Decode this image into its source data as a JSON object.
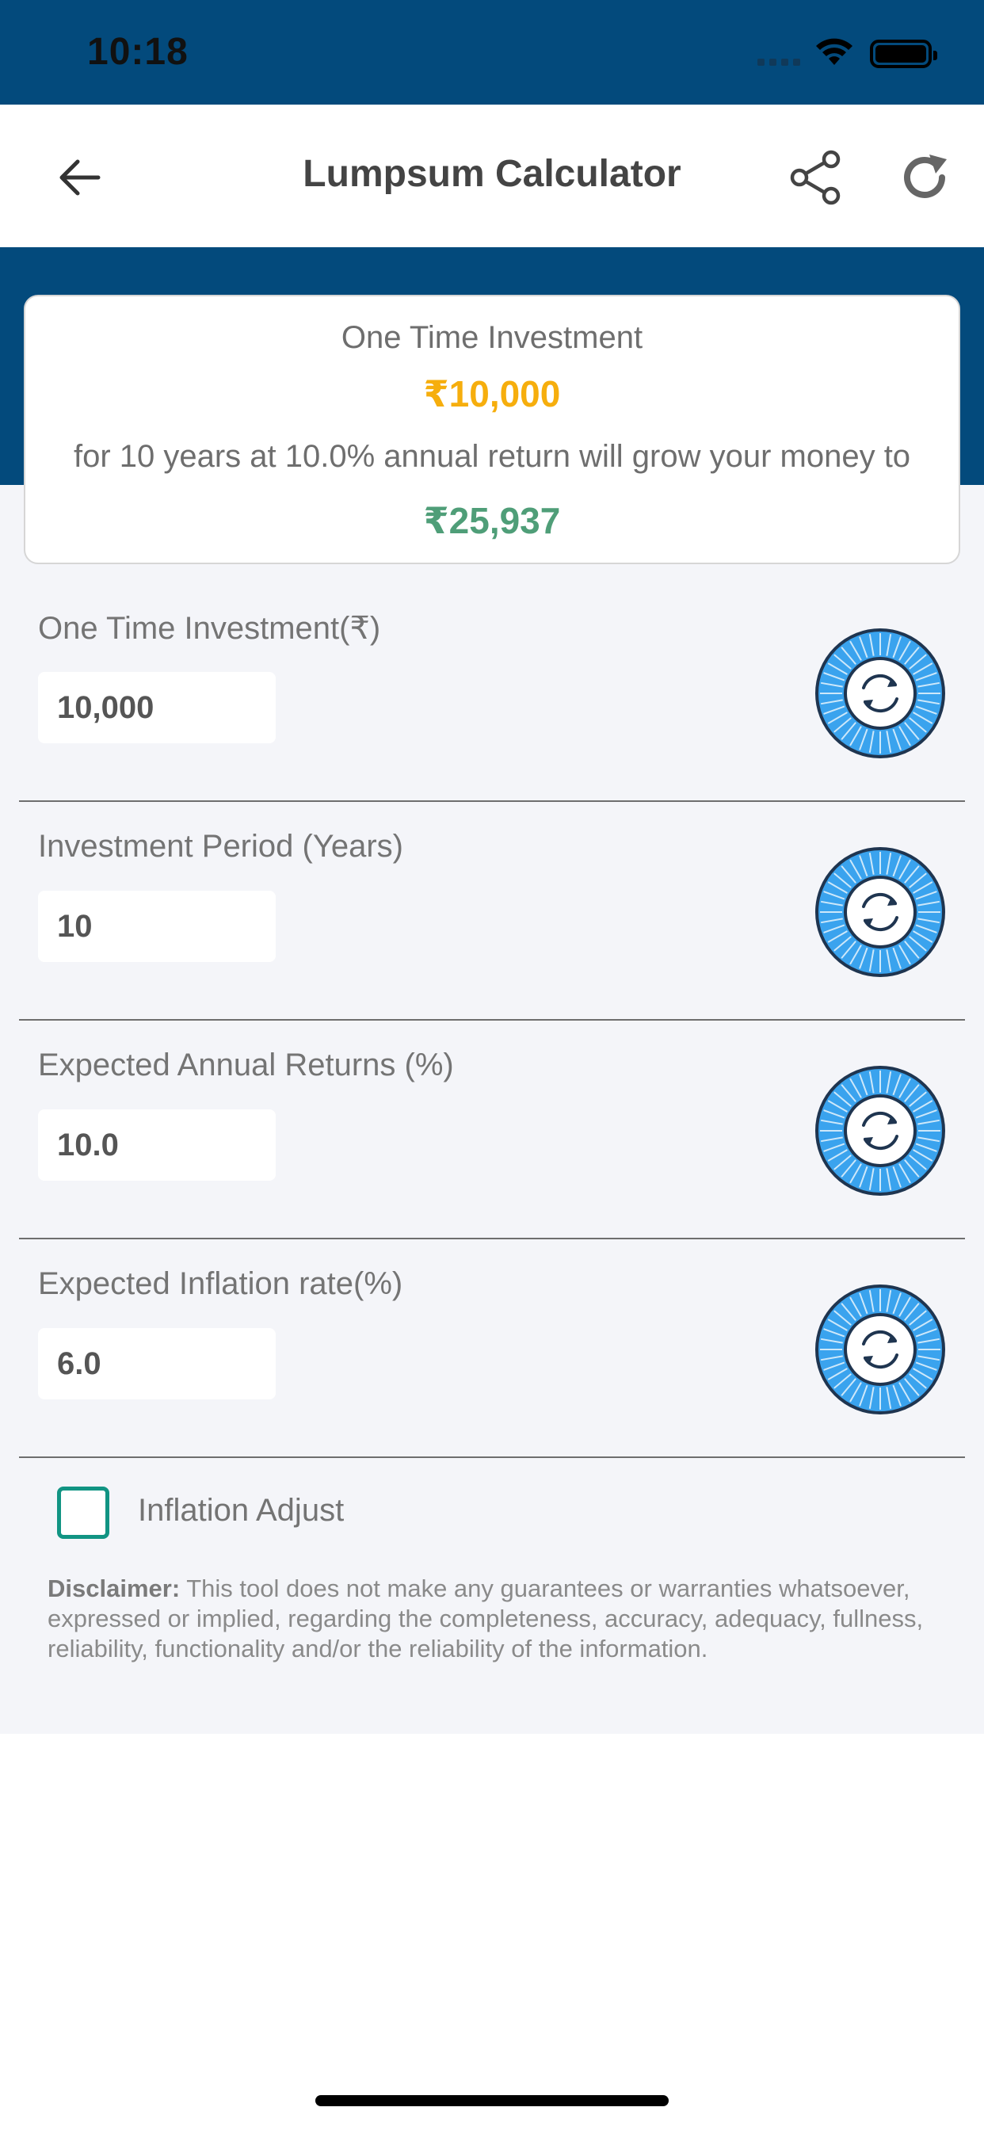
{
  "status_bar": {
    "time": "10:18"
  },
  "header": {
    "title": "Lumpsum Calculator",
    "back_icon": "back-arrow-icon",
    "share_icon": "share-icon",
    "refresh_icon": "refresh-icon"
  },
  "summary": {
    "label": "One Time Investment",
    "amount": "₹10,000",
    "description": "for 10 years at 10.0% annual return will grow your money to",
    "result": "₹25,937"
  },
  "fields": [
    {
      "label": "One Time Investment(₹)",
      "value": "10,000"
    },
    {
      "label": "Investment Period (Years)",
      "value": "10"
    },
    {
      "label": "Expected Annual Returns (%)",
      "value": "10.0"
    },
    {
      "label": "Expected Inflation rate(%)",
      "value": "6.0"
    }
  ],
  "inflation_adjust": {
    "label": "Inflation Adjust",
    "checked": false
  },
  "disclaimer": {
    "heading": "Disclaimer:",
    "text": "This tool does not make any guarantees or warranties whatsoever, expressed or implied, regarding the completeness, accuracy, adequacy, fullness, reliability, functionality and/or the reliability of the information."
  },
  "colors": {
    "brand_blue": "#034a7c",
    "amount_yellow": "#f6ae0d",
    "result_green": "#4f9e78",
    "dial_blue": "#3aa3ee",
    "checkbox_teal": "#119483"
  }
}
